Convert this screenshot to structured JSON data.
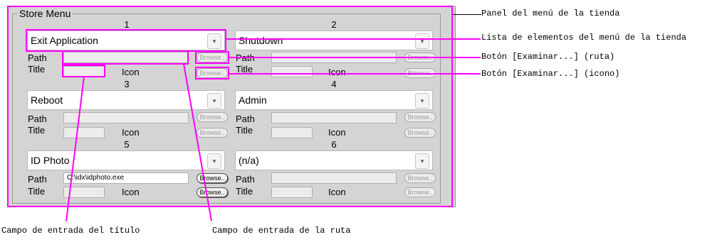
{
  "store_menu": {
    "title": "Store Menu",
    "labels": {
      "path": "Path",
      "title": "Title",
      "icon": "Icon",
      "browse": "Browse.."
    },
    "slots": [
      {
        "number": "1",
        "selected": "Exit Application",
        "path": "",
        "title": ""
      },
      {
        "number": "2",
        "selected": "Shutdown",
        "path": "",
        "title": ""
      },
      {
        "number": "3",
        "selected": "Reboot",
        "path": "",
        "title": ""
      },
      {
        "number": "4",
        "selected": "Admin",
        "path": "",
        "title": ""
      },
      {
        "number": "5",
        "selected": "ID Photo",
        "path": "C:\\idx\\idphoto.exe",
        "title": ""
      },
      {
        "number": "6",
        "selected": "(n/a)",
        "path": "",
        "title": ""
      }
    ]
  },
  "annotations": {
    "panel": "Panel del menú de la tienda",
    "list": "Lista de elementos del menú de la tienda",
    "browse_path": "Botón [Examinar...] (ruta)",
    "browse_icon": "Botón [Examinar...] (icono)",
    "title_field": "Campo de entrada del título",
    "path_field": "Campo de entrada de la ruta"
  },
  "colors": {
    "highlight": "#ff00ff",
    "panel_bg": "#d4d4d4"
  }
}
